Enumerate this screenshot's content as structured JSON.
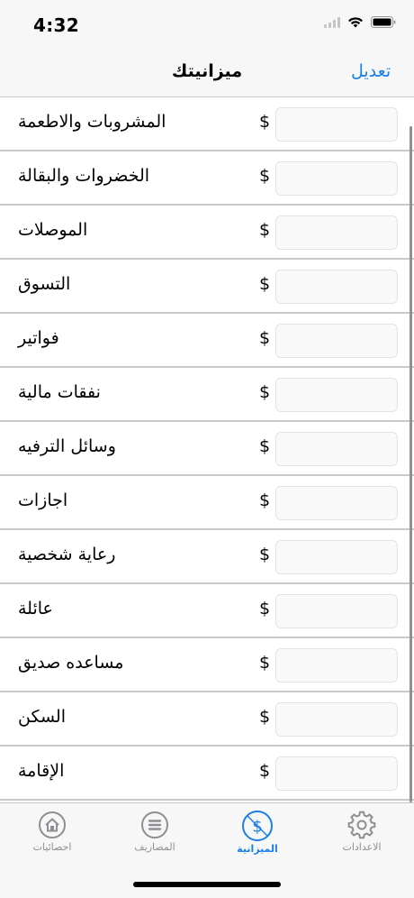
{
  "status_bar": {
    "time": "4:32"
  },
  "nav": {
    "title": "ميزانيتك",
    "edit_label": "تعديل"
  },
  "currency_symbol": "$",
  "categories": [
    {
      "label": "المشروبات والاطعمة",
      "value": ""
    },
    {
      "label": "الخضروات والبقالة",
      "value": ""
    },
    {
      "label": "الموصلات",
      "value": ""
    },
    {
      "label": "التسوق",
      "value": ""
    },
    {
      "label": "فواتير",
      "value": ""
    },
    {
      "label": "نفقات مالية",
      "value": ""
    },
    {
      "label": "وسائل الترفيه",
      "value": ""
    },
    {
      "label": "اجازات",
      "value": ""
    },
    {
      "label": "رعاية شخصية",
      "value": ""
    },
    {
      "label": "عائلة",
      "value": ""
    },
    {
      "label": "مساعده صديق",
      "value": ""
    },
    {
      "label": "السكن",
      "value": ""
    },
    {
      "label": "الإقامة",
      "value": ""
    }
  ],
  "tabs": [
    {
      "label": "احصائيات",
      "icon": "home-icon",
      "active": false
    },
    {
      "label": "المصاريف",
      "icon": "list-icon",
      "active": false
    },
    {
      "label": "الميزانية",
      "icon": "budget-icon",
      "active": true
    },
    {
      "label": "الاعدادات",
      "icon": "gear-icon",
      "active": false
    }
  ],
  "colors": {
    "accent": "#1a7fe6",
    "inactive": "#8e8e93",
    "bar_bg": "#f7f7f7"
  }
}
